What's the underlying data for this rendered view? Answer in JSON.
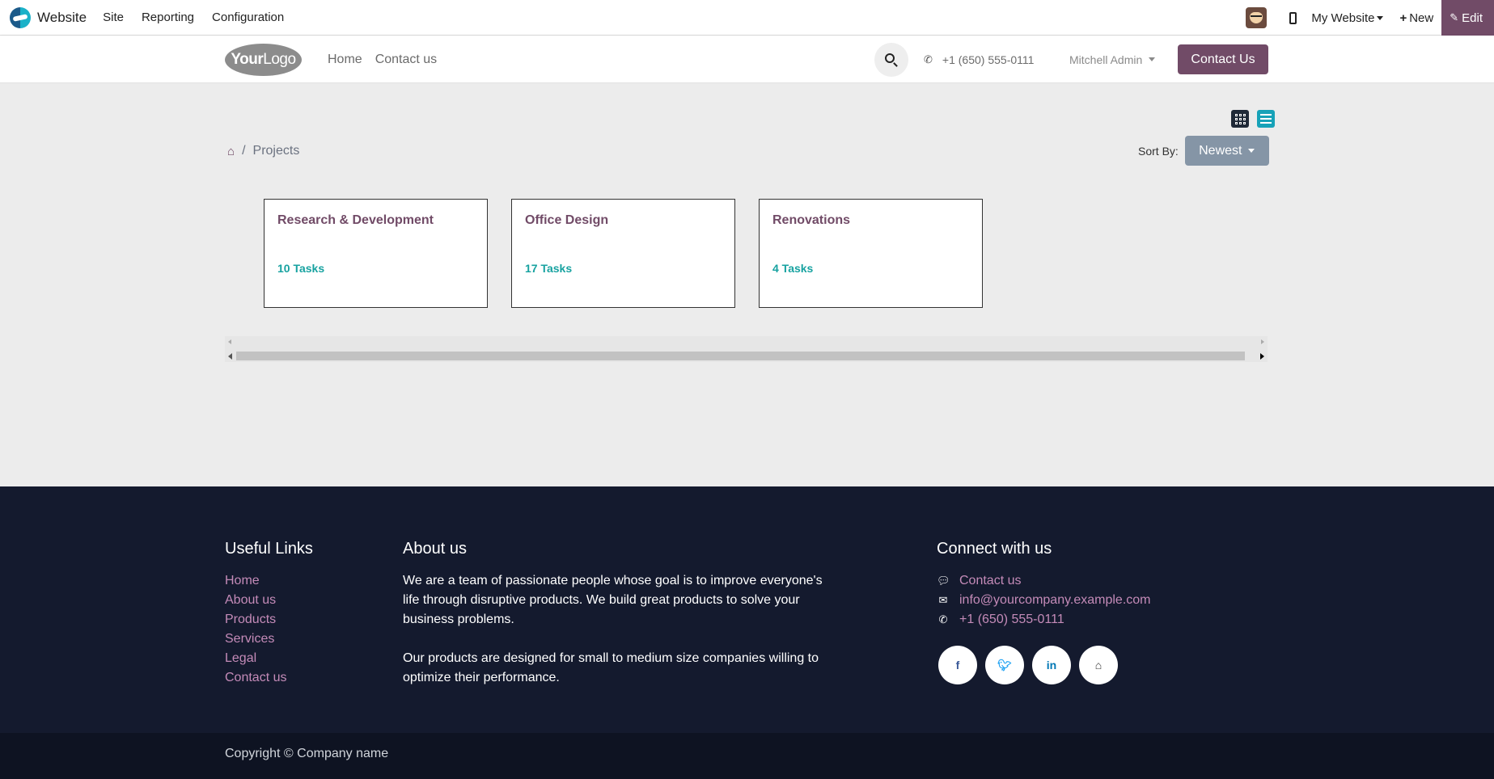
{
  "adminbar": {
    "brand": "Website",
    "menu": [
      "Site",
      "Reporting",
      "Configuration"
    ],
    "my_website": "My Website",
    "new": "New",
    "edit": "Edit"
  },
  "header": {
    "logo_text_bold": "Your",
    "logo_text": "Logo",
    "nav": [
      "Home",
      "Contact us"
    ],
    "phone": "+1 (650) 555-0111",
    "user": "Mitchell Admin",
    "contact_button": "Contact Us"
  },
  "main": {
    "breadcrumb_current": "Projects",
    "breadcrumb_sep": "/",
    "sort_label": "Sort By:",
    "sort_value": "Newest",
    "projects": [
      {
        "title": "Research & Development",
        "tasks": "10 Tasks"
      },
      {
        "title": "Office Design",
        "tasks": "17 Tasks"
      },
      {
        "title": "Renovations",
        "tasks": "4 Tasks"
      }
    ]
  },
  "footer": {
    "useful_links_title": "Useful Links",
    "useful_links": [
      "Home",
      "About us",
      "Products",
      "Services",
      "Legal",
      "Contact us"
    ],
    "about_title": "About us",
    "about_p1": "We are a team of passionate people whose goal is to improve everyone's life through disruptive products. We build great products to solve your business problems.",
    "about_p2": "Our products are designed for small to medium size companies willing to optimize their performance.",
    "connect_title": "Connect with us",
    "connect_contact": "Contact us",
    "connect_email": "info@yourcompany.example.com",
    "connect_phone": "+1 (650) 555-0111",
    "socials": [
      "facebook-icon",
      "twitter-icon",
      "linkedin-icon",
      "home-icon"
    ],
    "copyright": "Copyright © Company name"
  },
  "colors": {
    "brand": "#714b67",
    "accent": "#17a2a0",
    "footer_bg": "#141a2e",
    "link_pink": "#c48bb8"
  }
}
